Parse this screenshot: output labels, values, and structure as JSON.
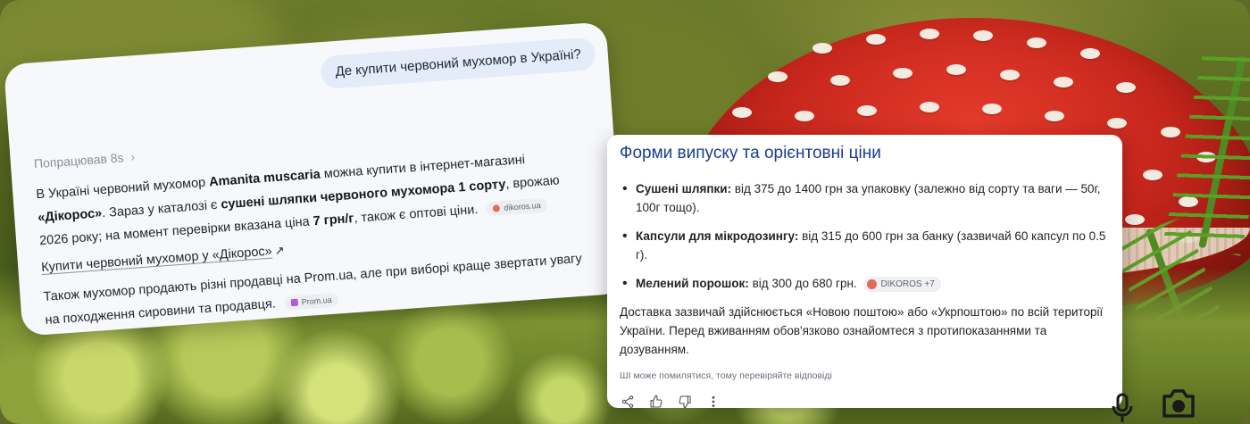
{
  "chat": {
    "user_question": "Де купити червоний мухомор в Україні?",
    "worked_label": "Попрацював 8s",
    "answer_parts": {
      "p1_a": "В Україні червоний мухомор ",
      "p1_b": "Amanita muscaria",
      "p1_c": " можна купити в інтернет-магазині ",
      "p1_d": "«Дікорос»",
      "p1_e": ". Зараз у каталозі є ",
      "p1_f": "сушені шляпки червоного мухомора 1 сорту",
      "p1_g": ", врожаю 2026 року; на момент перевірки вказана ціна ",
      "p1_h": "7 грн/г",
      "p1_i": ", також є оптові ціни.",
      "chip1": "dikoros.ua"
    },
    "link_text": "Купити червоний мухомор у «Дікорос»",
    "link_arrow": "↗",
    "answer2": "Також мухомор продають різні продавці на Prom.ua, але при виборі краще звертати увагу на походження сировини та продавця.",
    "chip2": "Prom.ua"
  },
  "info": {
    "title": "Форми випуску та орієнтовні ціни",
    "items": [
      {
        "label": "Сушені шляпки:",
        "text": " від 375 до 1400 грн за упаковку (залежно від сорту та ваги — 50г, 100г тощо)."
      },
      {
        "label": "Капсули для мікродозингу:",
        "text": " від 315 до 600 грн за банку (зазвичай 60 капсул по 0.5 г)."
      },
      {
        "label": "Мелений порошок:",
        "text": " від 300 до 680 грн.",
        "chip": "DIKOROS +7"
      }
    ],
    "paragraph": "Доставка зазвичай здійснюється «Новою поштою» або «Укрпоштою» по всій території України. Перед вживанням обов'язково ознайомтеся з протипоказаннями та дозуванням.",
    "disclaimer": "ШІ може помилятися, тому перевіряйте відповіді",
    "actions": [
      "share-icon",
      "thumbs-up-icon",
      "thumbs-down-icon",
      "more-vertical-icon"
    ]
  },
  "colors": {
    "title_blue": "#1a3d8f",
    "card_bg": "#ffffff",
    "chat_bg": "#f7f8fb",
    "bubble_bg": "#e4ecf9",
    "mushroom_red": "#c8271c"
  }
}
